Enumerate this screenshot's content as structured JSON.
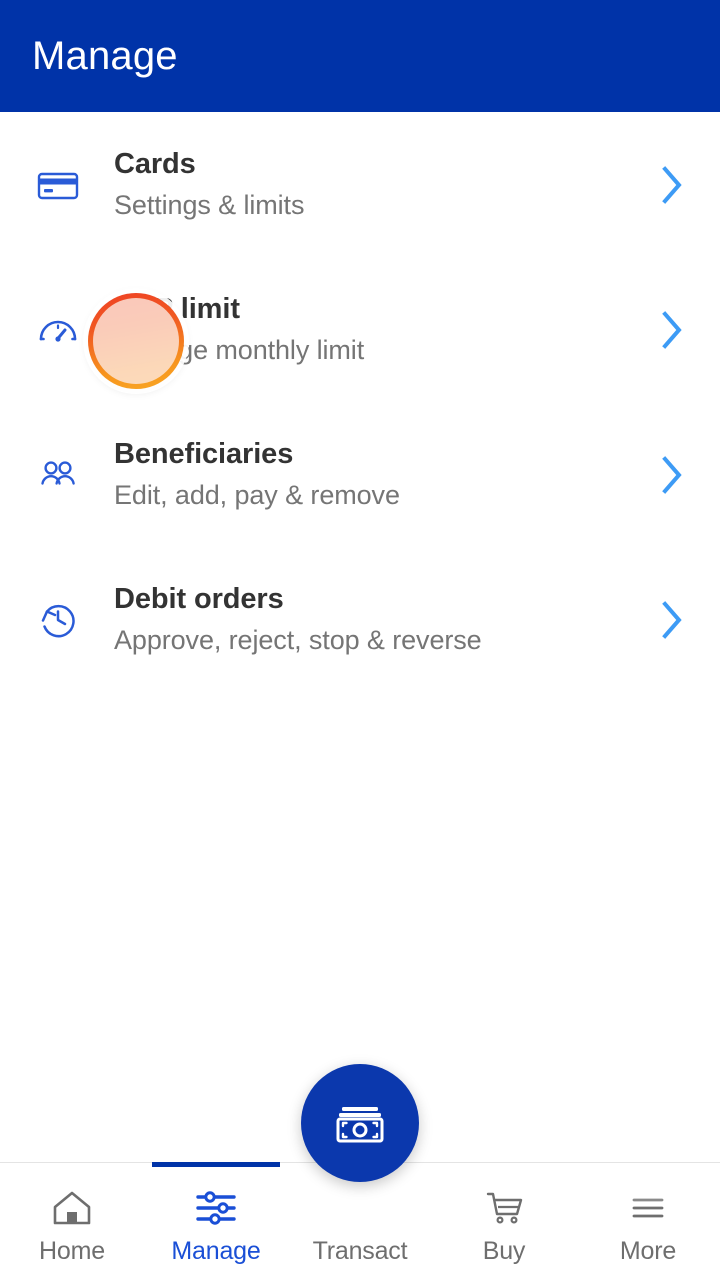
{
  "header": {
    "title": "Manage",
    "background_color": "#0033a8",
    "text_color": "#ffffff"
  },
  "menu": {
    "items": [
      {
        "icon": "credit-card-icon",
        "title": "Cards",
        "subtitle": "Settings & limits",
        "chevron": "chevron-right-icon"
      },
      {
        "icon": "gauge-icon",
        "title": "EAP limit",
        "subtitle": "Change monthly limit",
        "chevron": "chevron-right-icon"
      },
      {
        "icon": "people-icon",
        "title": "Beneficiaries",
        "subtitle": "Edit, add, pay & remove",
        "chevron": "chevron-right-icon"
      },
      {
        "icon": "clock-history-icon",
        "title": "Debit orders",
        "subtitle": "Approve, reject, stop & reverse",
        "chevron": "chevron-right-icon"
      }
    ]
  },
  "highlight": {
    "name": "tap-highlight-circle",
    "target": "EAP limit",
    "ring_color_start": "#ef4124",
    "ring_color_end": "#f9a825",
    "fill_color": "#fce8e0"
  },
  "bottom_nav": {
    "active": "Manage",
    "active_color": "#1a4fd6",
    "inactive_color": "#6e6e6e",
    "indicator_color": "#0033a8",
    "fab_color": "#0b38ad",
    "items": [
      {
        "label": "Home",
        "icon": "home-icon",
        "active": false
      },
      {
        "label": "Manage",
        "icon": "sliders-icon",
        "active": true
      },
      {
        "label": "Transact",
        "icon": "banknote-icon",
        "active": false
      },
      {
        "label": "Buy",
        "icon": "shopping-cart-icon",
        "active": false
      },
      {
        "label": "More",
        "icon": "hamburger-menu-icon",
        "active": false
      }
    ]
  }
}
